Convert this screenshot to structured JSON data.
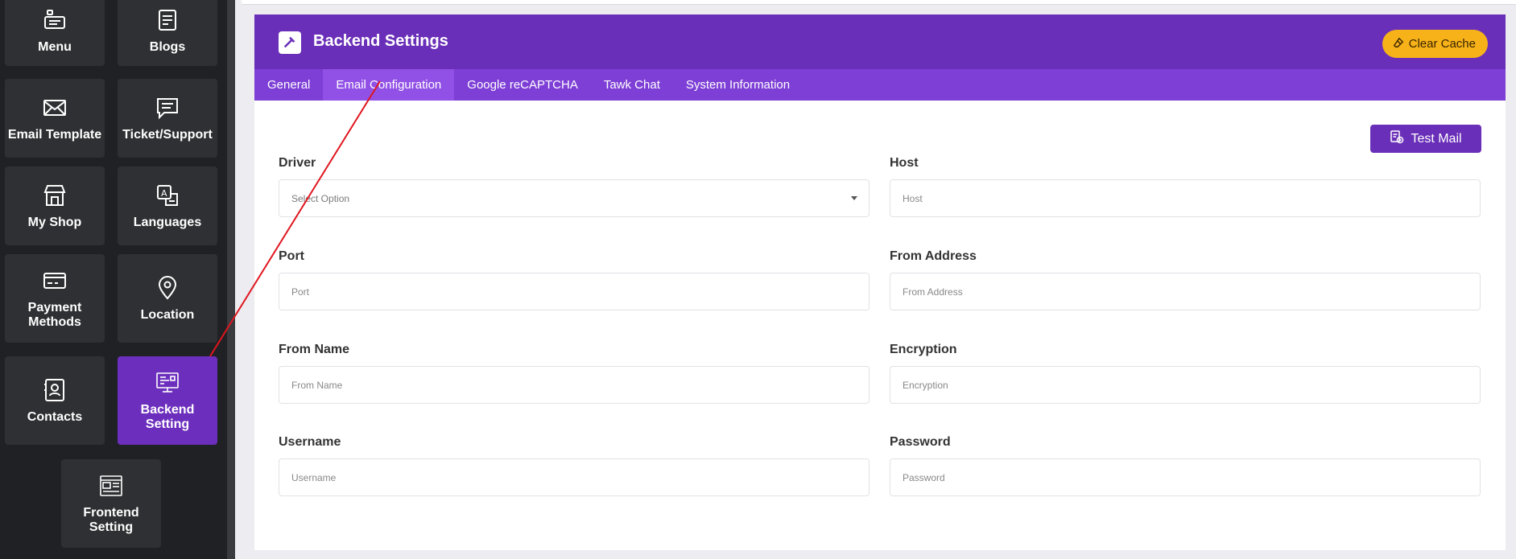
{
  "sidebar": {
    "tiles": [
      {
        "label": "Menu",
        "icon": "menu-icon"
      },
      {
        "label": "Blogs",
        "icon": "blog-icon"
      },
      {
        "label": "Email Template",
        "icon": "envelope-icon"
      },
      {
        "label": "Ticket/Support",
        "icon": "chat-icon"
      },
      {
        "label": "My Shop",
        "icon": "shop-icon"
      },
      {
        "label": "Languages",
        "icon": "translate-icon"
      },
      {
        "label": "Payment Methods",
        "icon": "card-icon"
      },
      {
        "label": "Location",
        "icon": "location-pin-icon"
      },
      {
        "label": "Contacts",
        "icon": "contact-book-icon"
      },
      {
        "label": "Backend Setting",
        "icon": "monitor-code-icon",
        "active": true
      },
      {
        "label": "Frontend Setting",
        "icon": "layout-icon"
      }
    ]
  },
  "header": {
    "title": "Backend Settings",
    "icon": "hammer-icon",
    "clear_cache_label": "Clear Cache"
  },
  "tabs": [
    {
      "label": "General"
    },
    {
      "label": "Email Configuration",
      "active": true
    },
    {
      "label": "Google reCAPTCHA"
    },
    {
      "label": "Tawk Chat"
    },
    {
      "label": "System Information"
    }
  ],
  "test_mail_label": "Test Mail",
  "form": {
    "driver": {
      "label": "Driver",
      "placeholder": "Select Option"
    },
    "host": {
      "label": "Host",
      "placeholder": "Host"
    },
    "port": {
      "label": "Port",
      "placeholder": "Port"
    },
    "from_address": {
      "label": "From Address",
      "placeholder": "From Address"
    },
    "from_name": {
      "label": "From Name",
      "placeholder": "From Name"
    },
    "encryption": {
      "label": "Encryption",
      "placeholder": "Encryption"
    },
    "username": {
      "label": "Username",
      "placeholder": "Username"
    },
    "password": {
      "label": "Password",
      "placeholder": "Password"
    }
  },
  "colors": {
    "sidebar_bg": "#202124",
    "tile_bg": "#2f3033",
    "accent": "#6a2fb8",
    "tab_bar": "#7e3fd6",
    "cache_button": "#f7b219",
    "annotation_line": "#e0161e"
  }
}
